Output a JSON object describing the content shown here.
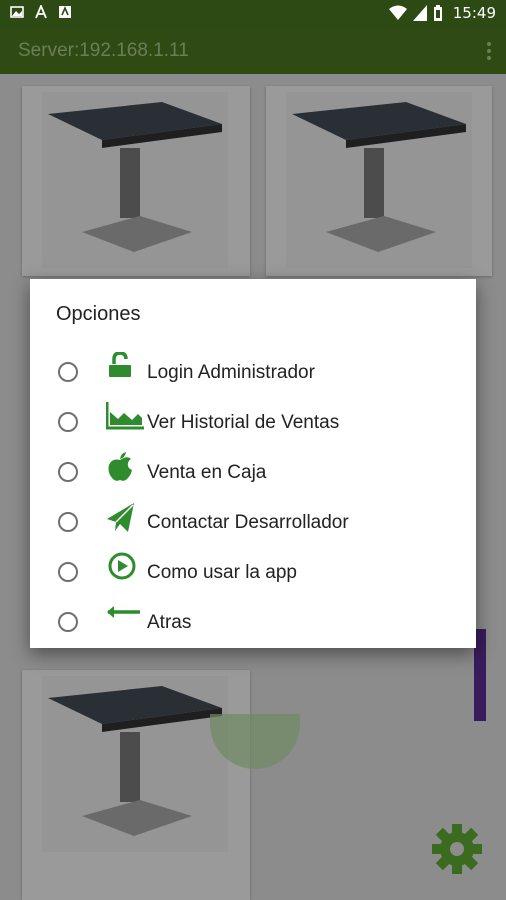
{
  "status_bar": {
    "time": "15:49",
    "icons": [
      "image-icon",
      "font-icon",
      "app-icon",
      "wifi-icon",
      "signal-icon",
      "battery-icon"
    ]
  },
  "app_bar": {
    "title": "Server:192.168.1.11",
    "overflow_icon": "more-vertical-icon"
  },
  "dialog": {
    "title": "Opciones",
    "options": [
      {
        "label": "Login Administrador",
        "icon": "unlock-icon",
        "selected": false
      },
      {
        "label": "Ver Historial de Ventas",
        "icon": "area-chart-icon",
        "selected": false
      },
      {
        "label": "Venta en Caja",
        "icon": "apple-icon",
        "selected": false
      },
      {
        "label": "Contactar Desarrollador",
        "icon": "send-icon",
        "selected": false
      },
      {
        "label": "Como usar la app",
        "icon": "play-circle-icon",
        "selected": false
      },
      {
        "label": "Atras",
        "icon": "arrow-left-icon",
        "selected": false
      }
    ]
  },
  "fab": {
    "icon": "gear-icon"
  },
  "colors": {
    "app_bar": "#2f4a12",
    "accent_green": "#2e8b2e",
    "scrim_background": "#8c8c8c",
    "dialog_background": "#ffffff"
  }
}
